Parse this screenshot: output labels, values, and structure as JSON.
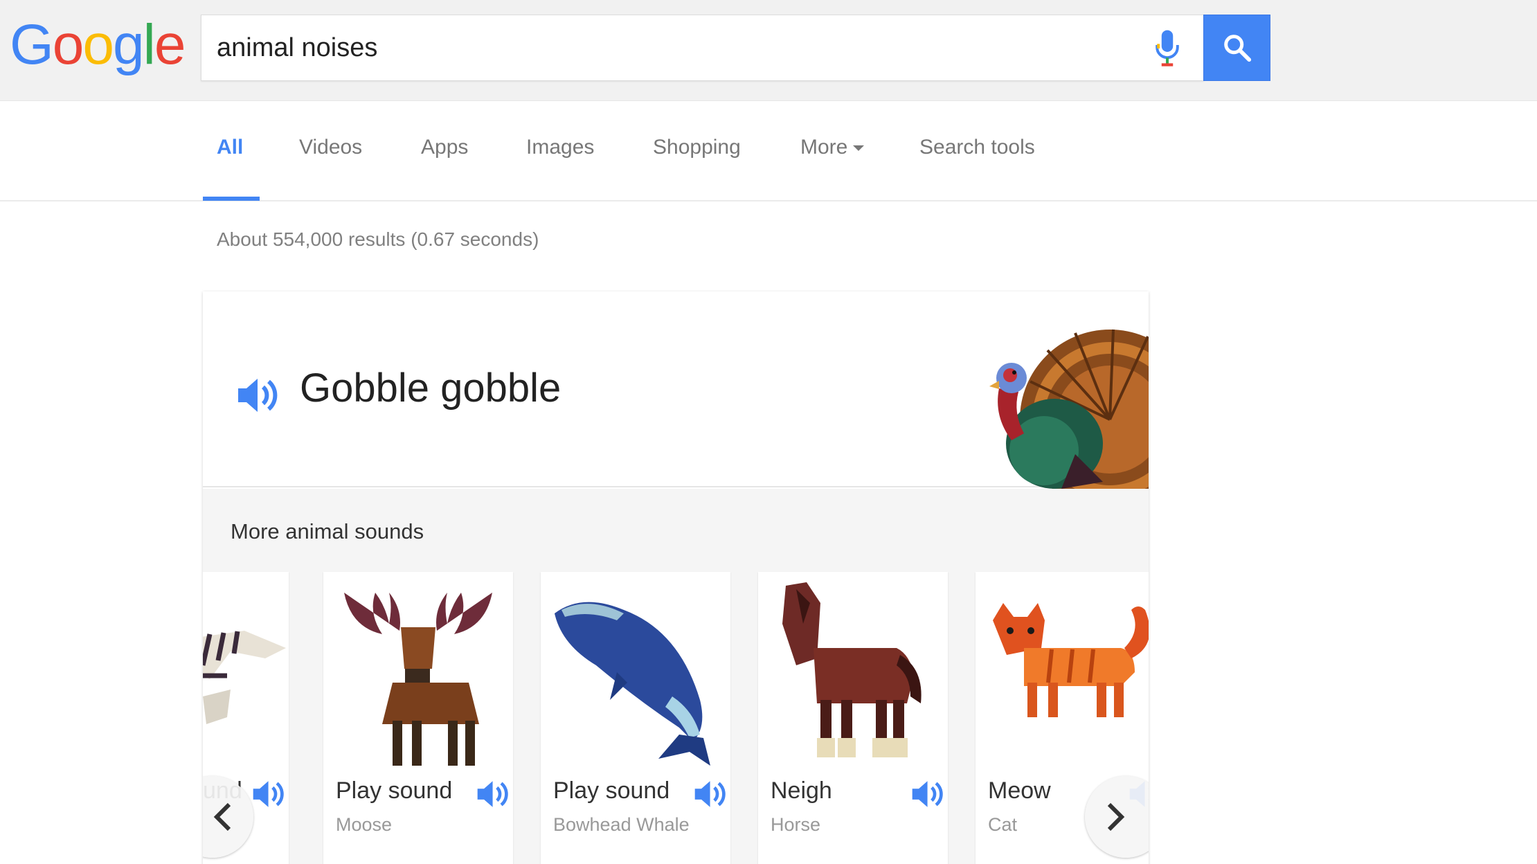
{
  "logo": {
    "letters": [
      {
        "char": "G",
        "color": "#4285f4"
      },
      {
        "char": "o",
        "color": "#ea4335"
      },
      {
        "char": "o",
        "color": "#fbbc05"
      },
      {
        "char": "g",
        "color": "#4285f4"
      },
      {
        "char": "l",
        "color": "#34a853"
      },
      {
        "char": "e",
        "color": "#ea4335"
      }
    ]
  },
  "search": {
    "query": "animal noises",
    "mic_icon": "microphone-icon",
    "button_icon": "magnifier-icon",
    "accent": "#4285f4"
  },
  "tabs": [
    {
      "label": "All",
      "active": true
    },
    {
      "label": "Videos"
    },
    {
      "label": "Apps"
    },
    {
      "label": "Images"
    },
    {
      "label": "Shopping"
    },
    {
      "label": "More"
    },
    {
      "label": "Search tools"
    }
  ],
  "results": {
    "stats": "About 554,000 results (0.67 seconds)"
  },
  "hero": {
    "title": "Gobble gobble",
    "speaker_icon": "speaker-icon",
    "animal": "turkey"
  },
  "more_sounds": {
    "title": "More animal sounds",
    "cards": [
      {
        "label": "und",
        "name": ""
      },
      {
        "label": "Play sound",
        "name": "Moose"
      },
      {
        "label": "Play sound",
        "name": "Bowhead Whale"
      },
      {
        "label": "Neigh",
        "name": "Horse"
      },
      {
        "label": "Meow",
        "name": "Cat"
      }
    ],
    "prev_icon": "chevron-left-icon",
    "next_icon": "chevron-right-icon"
  }
}
